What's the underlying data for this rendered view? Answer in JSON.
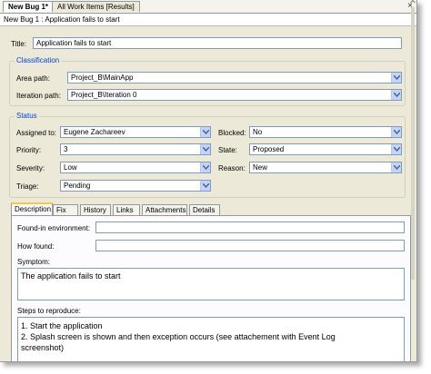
{
  "doc_tabs": [
    {
      "label": "New Bug 1*",
      "active": true
    },
    {
      "label": "All Work Items [Results]",
      "active": false
    }
  ],
  "close_glyph": "×",
  "header_title": "New Bug 1 : Application fails to start",
  "title": {
    "label": "Title:",
    "value": "Application fails to start"
  },
  "classification": {
    "heading": "Classification",
    "area_path": {
      "label": "Area path:",
      "value": "Project_B\\MainApp"
    },
    "iteration_path": {
      "label": "Iteration path:",
      "value": "Project_B\\Iteration 0"
    }
  },
  "status": {
    "heading": "Status",
    "assigned_to": {
      "label": "Assigned to:",
      "value": "Eugene Zachareev"
    },
    "priority": {
      "label": "Priority:",
      "value": "3"
    },
    "severity": {
      "label": "Severity:",
      "value": "Low"
    },
    "triage": {
      "label": "Triage:",
      "value": "Pending"
    },
    "blocked": {
      "label": "Blocked:",
      "value": "No"
    },
    "state": {
      "label": "State:",
      "value": "Proposed"
    },
    "reason": {
      "label": "Reason:",
      "value": "New"
    }
  },
  "tabs": [
    "Description",
    "Fix",
    "History",
    "Links",
    "Attachments",
    "Details"
  ],
  "description": {
    "found_in_label": "Found-in environment:",
    "found_in_value": "",
    "how_found_label": "How found:",
    "how_found_value": "",
    "symptom_label": "Symptom:",
    "symptom_value": "The application fails to start",
    "steps_label": "Steps to reproduce:",
    "steps": [
      "1. Start the application",
      "2. Splash screen is shown and then exception occurs (see attachement with Event Log",
      "screenshot)"
    ]
  },
  "colors": {
    "accent": "#0046d5",
    "tab_highlight": "#ffc83c",
    "border": "#7f9db9"
  }
}
